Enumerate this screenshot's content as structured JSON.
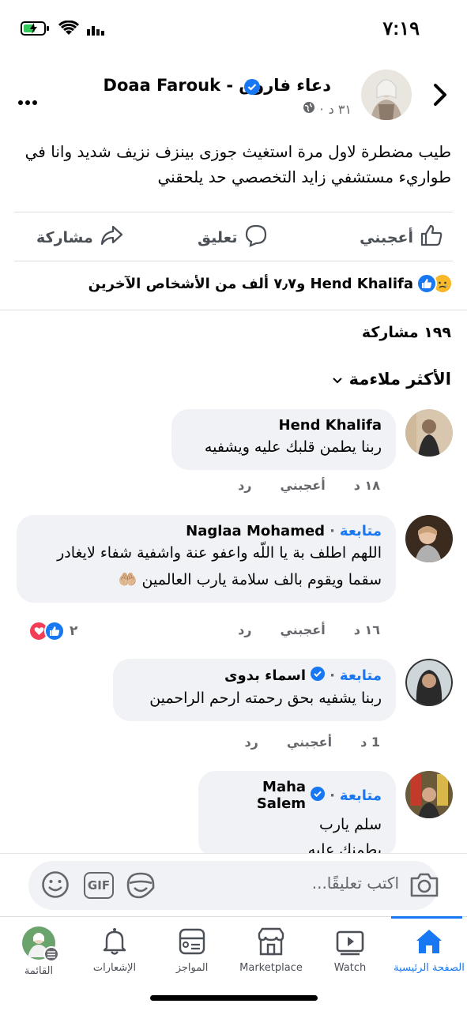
{
  "status_bar": {
    "time": "٧:١٩"
  },
  "post": {
    "author_name": "دعاء فاروق - Doaa Farouk",
    "time_ago": "٣١ د",
    "body": "طيب مضطرة لاول مرة استغيث جوزى بينزف نزيف شديد وانا في طواريء مستشفي زايد التخصصي حد يلحقني",
    "actions": {
      "like": "أعجبني",
      "comment": "تعليق",
      "share": "مشاركة"
    },
    "reactions_summary": "Hend Khalifa و٧٫٧ ألف من الأشخاص الآخرين",
    "shares": "١٩٩ مشاركة",
    "sort_label": "الأكثر ملاءمة"
  },
  "comments": [
    {
      "name": "Hend Khalifa",
      "follow": "",
      "text": "ربنا يطمن قلبك عليه ويشفيه",
      "time": "١٨ د",
      "like": "أعجبني",
      "reply": "رد"
    },
    {
      "name": "Naglaa Mohamed",
      "follow": "متابعة",
      "text": "اللهم اطلف بة يا اللّه واعفو عنة واشفية شفاء لايغادر سقما ويقوم بالف سلامة يارب العالمين 🤲🏼",
      "time": "١٦ د",
      "like": "أعجبني",
      "reply": "رد",
      "reactions_count": "٢"
    },
    {
      "name": "اسماء بدوى",
      "follow": "متابعة",
      "text": "ربنا يشفيه بحق رحمته ارحم الراحمين",
      "time": "1 د",
      "like": "أعجبني",
      "reply": "رد"
    },
    {
      "name": "Maha Salem",
      "follow": "متابعة",
      "text_line1": "سلم يارب",
      "text_line2": "يطمنك عليه"
    }
  ],
  "composer": {
    "placeholder": "اكتب تعليقًا...",
    "gif_label": "GIF"
  },
  "nav": {
    "home": "الصفحة الرئيسية",
    "watch": "Watch",
    "marketplace": "Marketplace",
    "dating": "المواجز",
    "notifications": "الإشعارات",
    "menu": "القائمة"
  },
  "colors": {
    "accent": "#1877f2",
    "bubble": "#f0f2f5",
    "muted": "#65676b"
  }
}
